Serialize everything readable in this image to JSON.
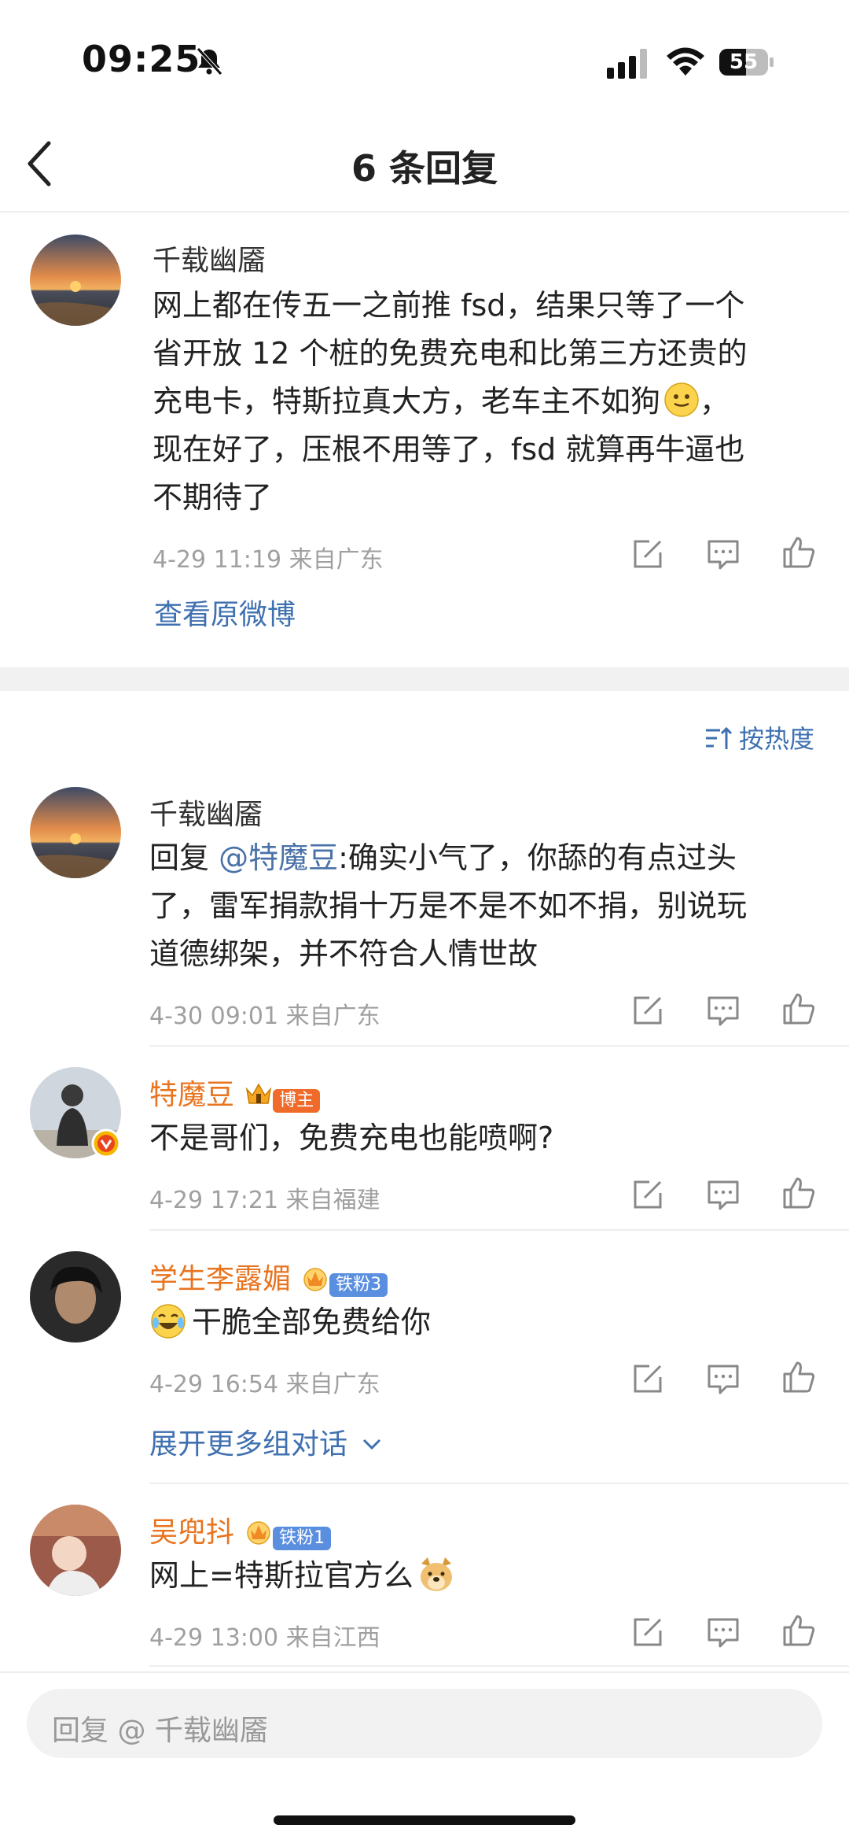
{
  "status_bar": {
    "time": "09:25",
    "battery": "55"
  },
  "nav": {
    "title": "6 条回复"
  },
  "original": {
    "username": "千载幽靥",
    "text_lines": [
      "网上都在传五一之前推 fsd，结果只等了一个",
      "省开放 12 个桩的免费充电和比第三方还贵的",
      "充电卡，特斯拉真大方，老车主不如狗",
      "现在好了，压根不用等了，fsd 就算再牛逼也",
      "不期待了"
    ],
    "emoji_end_line3": "，",
    "meta": "4-29 11:19  来自广东",
    "view_original": "查看原微博"
  },
  "sort": {
    "label": "按热度"
  },
  "replies": [
    {
      "username": "千载幽靥",
      "reply_prefix": "回复 ",
      "mention": "@特魔豆",
      "text_lines": [
        ":确实小气了，你舔的有点过头",
        "了，雷军捐款捐十万是不是不如不捐，别说玩",
        "道德绑架，并不符合人情世故"
      ],
      "meta": "4-30 09:01  来自广东"
    },
    {
      "username": "特魔豆",
      "badge": "博主",
      "text": "不是哥们，免费充电也能喷啊?",
      "meta": "4-29 17:21  来自福建"
    },
    {
      "username": "学生李露媚",
      "badge": "铁粉3",
      "text": "干脆全部免费给你",
      "meta": "4-29 16:54  来自广东"
    },
    {
      "expand_label": "展开更多组对话"
    },
    {
      "username": "吴兜抖",
      "badge": "铁粉1",
      "text": "网上=特斯拉官方么",
      "meta": "4-29 13:00  来自江西"
    }
  ],
  "reply_input": {
    "placeholder": "回复 @ 千载幽靥"
  },
  "colors": {
    "accent": "#3f70b0",
    "username_orange": "#e8741f",
    "meta_gray": "#a0a0a0"
  }
}
